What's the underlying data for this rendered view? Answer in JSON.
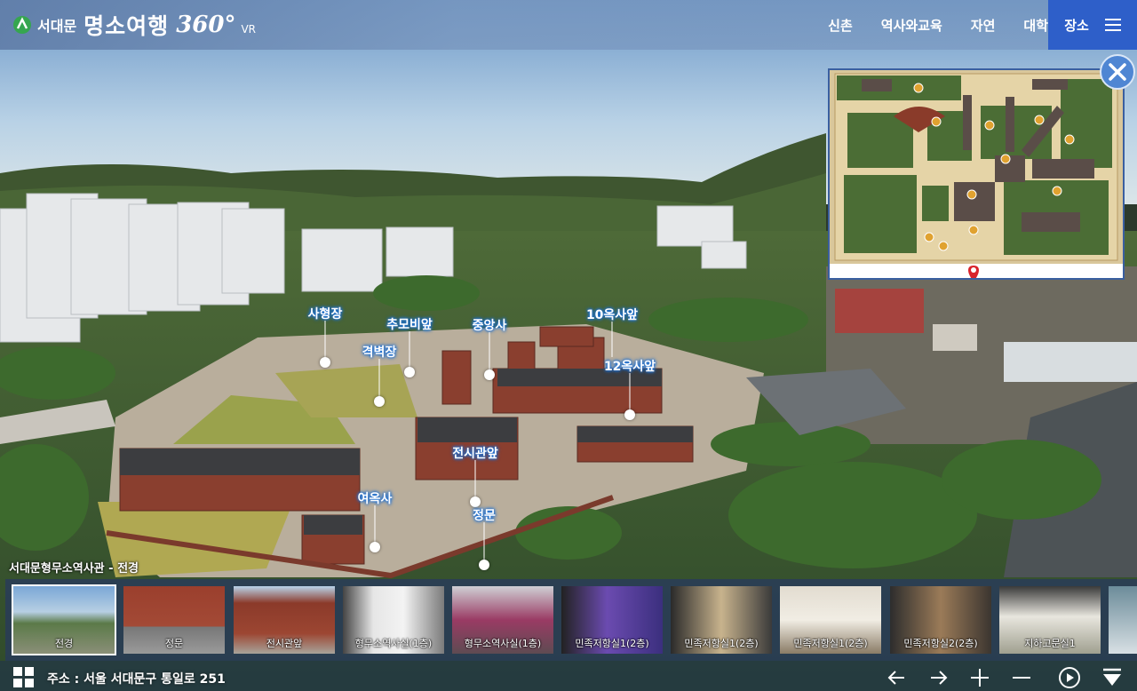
{
  "header": {
    "brand_small": "서대문",
    "brand_big": "명소여행",
    "brand_360": "360°",
    "brand_vr": "VR",
    "nav": [
      "신촌",
      "역사와교육",
      "자연",
      "대학"
    ],
    "place_button": "장소"
  },
  "hotspots": [
    {
      "label": "사형장"
    },
    {
      "label": "추모비앞"
    },
    {
      "label": "중앙사"
    },
    {
      "label": "10옥사앞"
    },
    {
      "label": "격벽장"
    },
    {
      "label": "12옥사앞"
    },
    {
      "label": "전시관앞"
    },
    {
      "label": "여옥사"
    },
    {
      "label": "정문"
    }
  ],
  "scene_title": "서대문형무소역사관 - 전경",
  "thumbnails": [
    {
      "label": "전경"
    },
    {
      "label": "정문"
    },
    {
      "label": "전시관앞"
    },
    {
      "label": "형무소역사실(1층)"
    },
    {
      "label": "형무소역사실(1층)"
    },
    {
      "label": "민족저항실1(2층)"
    },
    {
      "label": "민족저항실1(2층)"
    },
    {
      "label": "민족저항실1(2층)"
    },
    {
      "label": "민족저항실2(2층)"
    },
    {
      "label": "지하고문실1"
    }
  ],
  "address": "주소 : 서울 서대문구 통일로 251",
  "controls": [
    "arrow-left-icon",
    "arrow-right-icon",
    "zoom-in-icon",
    "zoom-out-icon",
    "compass-icon",
    "collapse-icon"
  ],
  "colors": {
    "accent": "#2e5fc9",
    "header": "#607da8",
    "hotspot_glow": "#1b6fd4"
  }
}
